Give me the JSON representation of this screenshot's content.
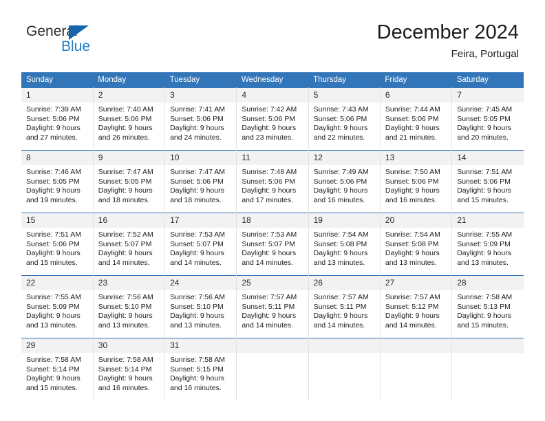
{
  "brand": {
    "name_dark": "General",
    "name_blue": "Blue",
    "accent_color": "#1465ab",
    "blue_color": "#1f7cc4"
  },
  "header": {
    "title": "December 2024",
    "location": "Feira, Portugal",
    "header_bg": "#3275b8",
    "header_text_color": "#ffffff"
  },
  "weekday_headers": [
    "Sunday",
    "Monday",
    "Tuesday",
    "Wednesday",
    "Thursday",
    "Friday",
    "Saturday"
  ],
  "labels": {
    "sunrise_prefix": "Sunrise:",
    "sunset_prefix": "Sunset:",
    "daylight_prefix": "Daylight:"
  },
  "weeks": [
    [
      {
        "day": "1",
        "sunrise": "Sunrise: 7:39 AM",
        "sunset": "Sunset: 5:06 PM",
        "daylight_1": "Daylight: 9 hours",
        "daylight_2": "and 27 minutes."
      },
      {
        "day": "2",
        "sunrise": "Sunrise: 7:40 AM",
        "sunset": "Sunset: 5:06 PM",
        "daylight_1": "Daylight: 9 hours",
        "daylight_2": "and 26 minutes."
      },
      {
        "day": "3",
        "sunrise": "Sunrise: 7:41 AM",
        "sunset": "Sunset: 5:06 PM",
        "daylight_1": "Daylight: 9 hours",
        "daylight_2": "and 24 minutes."
      },
      {
        "day": "4",
        "sunrise": "Sunrise: 7:42 AM",
        "sunset": "Sunset: 5:06 PM",
        "daylight_1": "Daylight: 9 hours",
        "daylight_2": "and 23 minutes."
      },
      {
        "day": "5",
        "sunrise": "Sunrise: 7:43 AM",
        "sunset": "Sunset: 5:06 PM",
        "daylight_1": "Daylight: 9 hours",
        "daylight_2": "and 22 minutes."
      },
      {
        "day": "6",
        "sunrise": "Sunrise: 7:44 AM",
        "sunset": "Sunset: 5:06 PM",
        "daylight_1": "Daylight: 9 hours",
        "daylight_2": "and 21 minutes."
      },
      {
        "day": "7",
        "sunrise": "Sunrise: 7:45 AM",
        "sunset": "Sunset: 5:05 PM",
        "daylight_1": "Daylight: 9 hours",
        "daylight_2": "and 20 minutes."
      }
    ],
    [
      {
        "day": "8",
        "sunrise": "Sunrise: 7:46 AM",
        "sunset": "Sunset: 5:05 PM",
        "daylight_1": "Daylight: 9 hours",
        "daylight_2": "and 19 minutes."
      },
      {
        "day": "9",
        "sunrise": "Sunrise: 7:47 AM",
        "sunset": "Sunset: 5:05 PM",
        "daylight_1": "Daylight: 9 hours",
        "daylight_2": "and 18 minutes."
      },
      {
        "day": "10",
        "sunrise": "Sunrise: 7:47 AM",
        "sunset": "Sunset: 5:06 PM",
        "daylight_1": "Daylight: 9 hours",
        "daylight_2": "and 18 minutes."
      },
      {
        "day": "11",
        "sunrise": "Sunrise: 7:48 AM",
        "sunset": "Sunset: 5:06 PM",
        "daylight_1": "Daylight: 9 hours",
        "daylight_2": "and 17 minutes."
      },
      {
        "day": "12",
        "sunrise": "Sunrise: 7:49 AM",
        "sunset": "Sunset: 5:06 PM",
        "daylight_1": "Daylight: 9 hours",
        "daylight_2": "and 16 minutes."
      },
      {
        "day": "13",
        "sunrise": "Sunrise: 7:50 AM",
        "sunset": "Sunset: 5:06 PM",
        "daylight_1": "Daylight: 9 hours",
        "daylight_2": "and 16 minutes."
      },
      {
        "day": "14",
        "sunrise": "Sunrise: 7:51 AM",
        "sunset": "Sunset: 5:06 PM",
        "daylight_1": "Daylight: 9 hours",
        "daylight_2": "and 15 minutes."
      }
    ],
    [
      {
        "day": "15",
        "sunrise": "Sunrise: 7:51 AM",
        "sunset": "Sunset: 5:06 PM",
        "daylight_1": "Daylight: 9 hours",
        "daylight_2": "and 15 minutes."
      },
      {
        "day": "16",
        "sunrise": "Sunrise: 7:52 AM",
        "sunset": "Sunset: 5:07 PM",
        "daylight_1": "Daylight: 9 hours",
        "daylight_2": "and 14 minutes."
      },
      {
        "day": "17",
        "sunrise": "Sunrise: 7:53 AM",
        "sunset": "Sunset: 5:07 PM",
        "daylight_1": "Daylight: 9 hours",
        "daylight_2": "and 14 minutes."
      },
      {
        "day": "18",
        "sunrise": "Sunrise: 7:53 AM",
        "sunset": "Sunset: 5:07 PM",
        "daylight_1": "Daylight: 9 hours",
        "daylight_2": "and 14 minutes."
      },
      {
        "day": "19",
        "sunrise": "Sunrise: 7:54 AM",
        "sunset": "Sunset: 5:08 PM",
        "daylight_1": "Daylight: 9 hours",
        "daylight_2": "and 13 minutes."
      },
      {
        "day": "20",
        "sunrise": "Sunrise: 7:54 AM",
        "sunset": "Sunset: 5:08 PM",
        "daylight_1": "Daylight: 9 hours",
        "daylight_2": "and 13 minutes."
      },
      {
        "day": "21",
        "sunrise": "Sunrise: 7:55 AM",
        "sunset": "Sunset: 5:09 PM",
        "daylight_1": "Daylight: 9 hours",
        "daylight_2": "and 13 minutes."
      }
    ],
    [
      {
        "day": "22",
        "sunrise": "Sunrise: 7:55 AM",
        "sunset": "Sunset: 5:09 PM",
        "daylight_1": "Daylight: 9 hours",
        "daylight_2": "and 13 minutes."
      },
      {
        "day": "23",
        "sunrise": "Sunrise: 7:56 AM",
        "sunset": "Sunset: 5:10 PM",
        "daylight_1": "Daylight: 9 hours",
        "daylight_2": "and 13 minutes."
      },
      {
        "day": "24",
        "sunrise": "Sunrise: 7:56 AM",
        "sunset": "Sunset: 5:10 PM",
        "daylight_1": "Daylight: 9 hours",
        "daylight_2": "and 13 minutes."
      },
      {
        "day": "25",
        "sunrise": "Sunrise: 7:57 AM",
        "sunset": "Sunset: 5:11 PM",
        "daylight_1": "Daylight: 9 hours",
        "daylight_2": "and 14 minutes."
      },
      {
        "day": "26",
        "sunrise": "Sunrise: 7:57 AM",
        "sunset": "Sunset: 5:11 PM",
        "daylight_1": "Daylight: 9 hours",
        "daylight_2": "and 14 minutes."
      },
      {
        "day": "27",
        "sunrise": "Sunrise: 7:57 AM",
        "sunset": "Sunset: 5:12 PM",
        "daylight_1": "Daylight: 9 hours",
        "daylight_2": "and 14 minutes."
      },
      {
        "day": "28",
        "sunrise": "Sunrise: 7:58 AM",
        "sunset": "Sunset: 5:13 PM",
        "daylight_1": "Daylight: 9 hours",
        "daylight_2": "and 15 minutes."
      }
    ],
    [
      {
        "day": "29",
        "sunrise": "Sunrise: 7:58 AM",
        "sunset": "Sunset: 5:14 PM",
        "daylight_1": "Daylight: 9 hours",
        "daylight_2": "and 15 minutes."
      },
      {
        "day": "30",
        "sunrise": "Sunrise: 7:58 AM",
        "sunset": "Sunset: 5:14 PM",
        "daylight_1": "Daylight: 9 hours",
        "daylight_2": "and 16 minutes."
      },
      {
        "day": "31",
        "sunrise": "Sunrise: 7:58 AM",
        "sunset": "Sunset: 5:15 PM",
        "daylight_1": "Daylight: 9 hours",
        "daylight_2": "and 16 minutes."
      },
      {
        "day": "",
        "sunrise": "",
        "sunset": "",
        "daylight_1": "",
        "daylight_2": ""
      },
      {
        "day": "",
        "sunrise": "",
        "sunset": "",
        "daylight_1": "",
        "daylight_2": ""
      },
      {
        "day": "",
        "sunrise": "",
        "sunset": "",
        "daylight_1": "",
        "daylight_2": ""
      },
      {
        "day": "",
        "sunrise": "",
        "sunset": "",
        "daylight_1": "",
        "daylight_2": ""
      }
    ]
  ]
}
